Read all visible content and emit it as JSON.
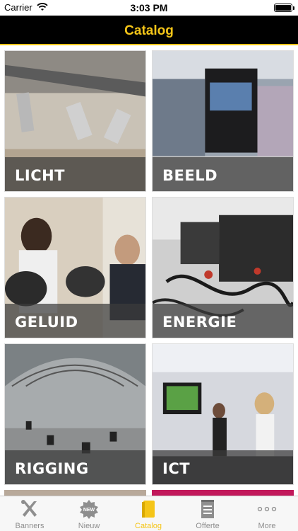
{
  "status_bar": {
    "carrier": "Carrier",
    "time": "3:03 PM"
  },
  "nav": {
    "title": "Catalog"
  },
  "catalog": {
    "items": [
      {
        "label": "LICHT"
      },
      {
        "label": "BEELD"
      },
      {
        "label": "GELUID"
      },
      {
        "label": "ENERGIE"
      },
      {
        "label": "RIGGING"
      },
      {
        "label": "ICT"
      }
    ]
  },
  "tabs": [
    {
      "label": "Banners",
      "icon": "tools-icon",
      "active": false
    },
    {
      "label": "Nieuw",
      "icon": "new-badge-icon",
      "active": false
    },
    {
      "label": "Catalog",
      "icon": "book-icon",
      "active": true
    },
    {
      "label": "Offerte",
      "icon": "notepad-icon",
      "active": false
    },
    {
      "label": "More",
      "icon": "more-dots-icon",
      "active": false
    }
  ],
  "colors": {
    "accent": "#f5c518",
    "nav_background": "#000000",
    "inactive_tab": "#8e8e8e"
  }
}
